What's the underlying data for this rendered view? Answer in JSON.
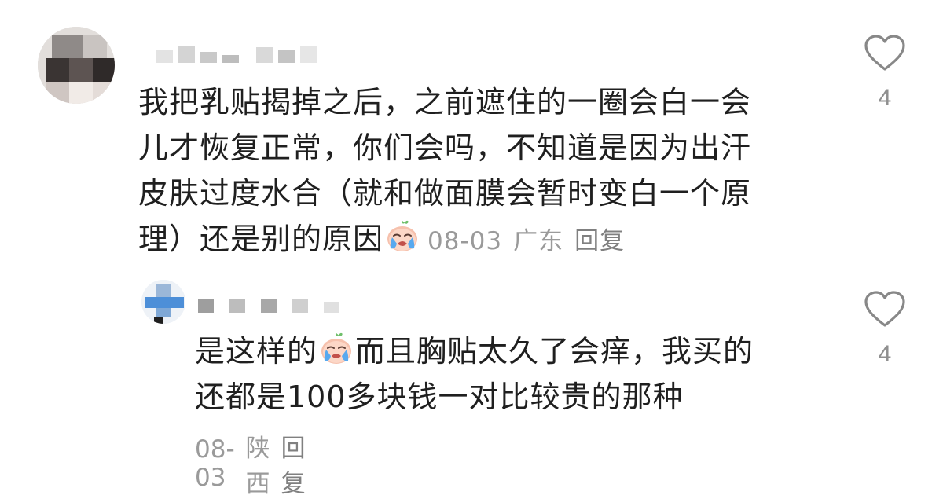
{
  "comments": [
    {
      "lines": [
        "我把乳贴揭掉之后，之前遮住的一圈会白一会",
        "儿才恢复正常，你们会吗，不知道是因为出汗",
        "皮肤过度水合（就和做面膜会暂时变白一个原",
        "理）还是别的原因"
      ],
      "date": "08-03",
      "location": "广东",
      "reply_label": "回复",
      "like_count": "4",
      "emoji_icon": "crying-peach-emoji"
    },
    {
      "lines_before_emoji": "是这样的",
      "lines_after_emoji": "而且胸贴太久了会痒，我买的",
      "line2": "还都是100多块钱一对比较贵的那种",
      "date": "08-03",
      "location": "陕西",
      "reply_label": "回复",
      "like_count": "4",
      "emoji_icon": "crying-peach-emoji"
    }
  ],
  "icons": {
    "like": "heart-outline-icon",
    "like_color": "#888888"
  }
}
